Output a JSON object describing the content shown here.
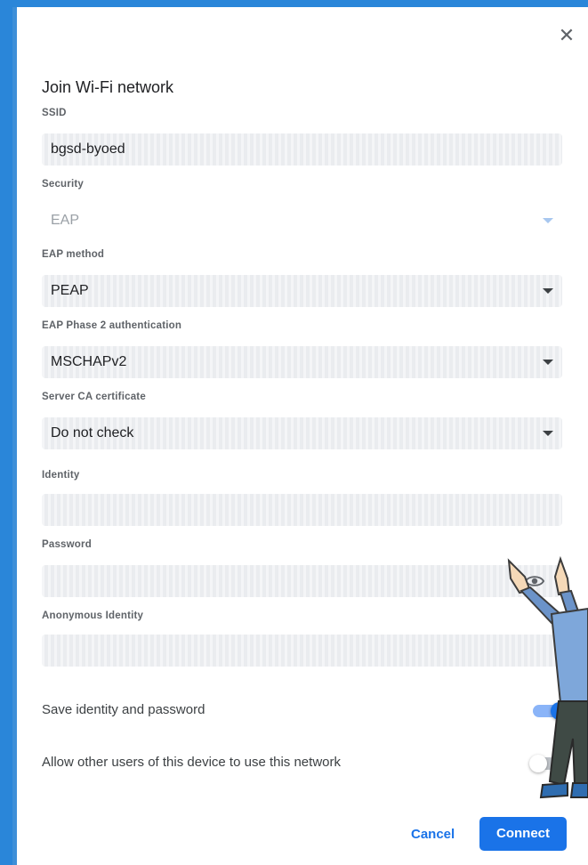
{
  "dialog": {
    "title": "Join Wi-Fi network",
    "close_icon": "close-icon"
  },
  "ssid": {
    "label": "SSID",
    "value": "bgsd-byoed"
  },
  "security": {
    "label": "Security",
    "value": "EAP",
    "disabled": true
  },
  "eap_method": {
    "label": "EAP method",
    "value": "PEAP"
  },
  "phase2": {
    "label": "EAP Phase 2 authentication",
    "value": "MSCHAPv2"
  },
  "server_ca": {
    "label": "Server CA certificate",
    "value": "Do not check"
  },
  "identity": {
    "label": "Identity",
    "value": ""
  },
  "password": {
    "label": "Password",
    "value": "",
    "show_icon": "eye-icon"
  },
  "anonymous_identity": {
    "label": "Anonymous Identity",
    "value": ""
  },
  "save_identity": {
    "label": "Save identity and password",
    "checked": true
  },
  "share_network": {
    "label": "Allow other users of this device to use this network",
    "checked": false
  },
  "buttons": {
    "cancel": "Cancel",
    "connect": "Connect"
  },
  "colors": {
    "accent": "#1a73e8",
    "background": "#2a86d9"
  }
}
